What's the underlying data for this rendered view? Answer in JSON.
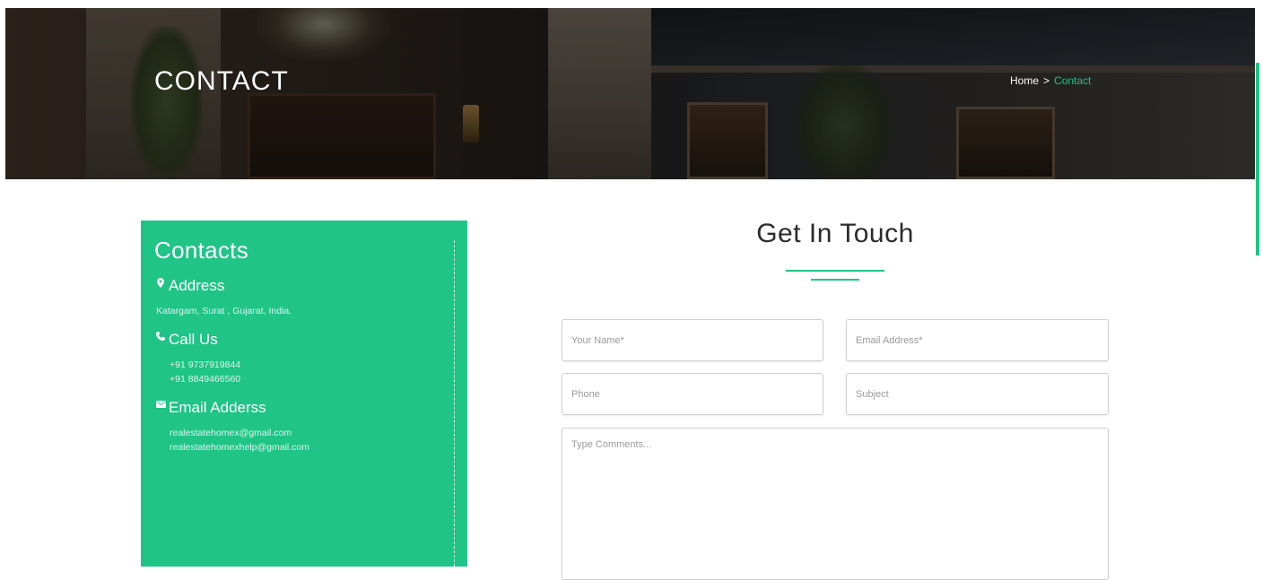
{
  "hero": {
    "title": "CONTACT",
    "breadcrumb": {
      "home": "Home",
      "separator": ">",
      "current": "Contact"
    }
  },
  "contacts": {
    "title": "Contacts",
    "address": {
      "icon": "map-marker-icon",
      "label": "Address",
      "value": "Katargam, Surat , Gujarat, India."
    },
    "call": {
      "icon": "phone-icon",
      "label": "Call Us",
      "phones": [
        "+91 9737919844",
        "+91 8849466560"
      ]
    },
    "email": {
      "icon": "envelope-icon",
      "label": "Email Adderss",
      "emails": [
        "realestatehomex@gmail.com",
        "realestatehomexhelp@gmail.com"
      ]
    }
  },
  "form": {
    "title": "Get In Touch",
    "name_placeholder": "Your Name*",
    "email_placeholder": "Email Address*",
    "phone_placeholder": "Phone",
    "subject_placeholder": "Subject",
    "comment_placeholder": "Type Comments..."
  },
  "colors": {
    "accent": "#1fc486",
    "title_text": "#2b2b2b"
  }
}
